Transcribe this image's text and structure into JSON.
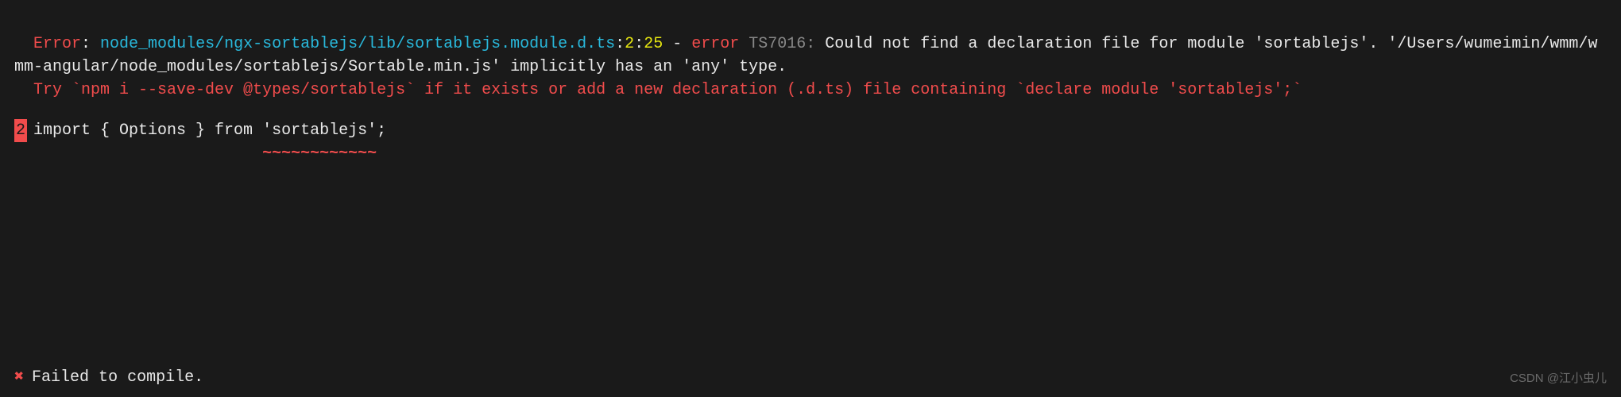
{
  "error": {
    "prefix": "Error",
    "colon1": ": ",
    "filepath": "node_modules/ngx-sortablejs/lib/sortablejs.module.d.ts",
    "colon2": ":",
    "line": "2",
    "colon3": ":",
    "col": "25",
    "dash": " - ",
    "errorWord": "error",
    "space": " ",
    "errorCode": "TS7016:",
    "message1": " Could not find a declaration file for module 'sortablejs'. '/Users/wumeimin/wmm/wmm-angular/node_modules/sortablejs/Sortable.min.js' implicitly has an 'any' type.",
    "suggestion": "  Try `npm i --save-dev @types/sortablejs` if it exists or add a new declaration (.d.ts) file containing `declare module 'sortablejs';`"
  },
  "code": {
    "lineNumber": "2",
    "content": " import { Options } from 'sortablejs';",
    "underline": "                          ~~~~~~~~~~~~"
  },
  "failed": {
    "icon": "✖",
    "text": "Failed to compile."
  },
  "watermark": "CSDN @江小虫儿"
}
